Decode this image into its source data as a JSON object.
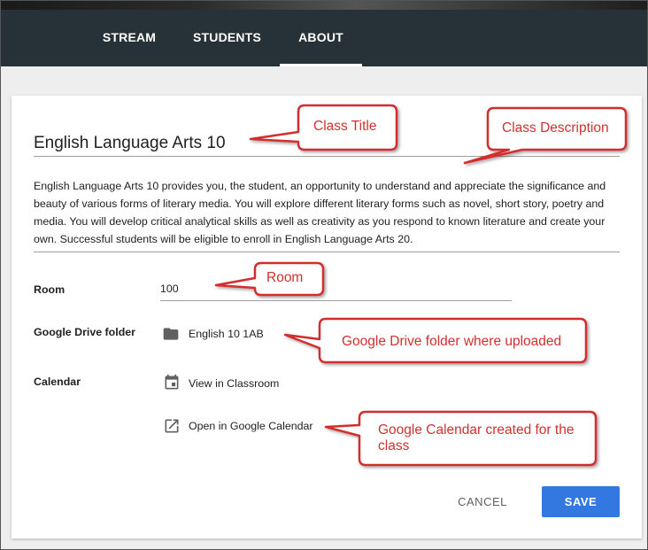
{
  "tabs": [
    {
      "label": "STREAM"
    },
    {
      "label": "STUDENTS"
    },
    {
      "label": "ABOUT"
    }
  ],
  "about": {
    "title": "English Language Arts 10",
    "description": "English Language Arts 10 provides you, the student, an opportunity to understand and appreciate the significance and beauty of various forms of literary media. You will explore different literary forms such as novel, short story, poetry and media. You will develop critical analytical skills as well as creativity as you respond to known literature and create your own. Successful students will be eligible to enroll in English Language Arts 20.",
    "room_label": "Room",
    "room_value": "100",
    "drive_label": "Google Drive folder",
    "drive_folder": "English 10 1AB",
    "calendar_label": "Calendar",
    "view_classroom": "View in Classroom",
    "open_calendar": "Open in Google Calendar"
  },
  "actions": {
    "cancel": "CANCEL",
    "save": "SAVE"
  },
  "annotations": {
    "class_title": "Class Title",
    "class_description": "Class Description",
    "room": "Room",
    "drive": "Google Drive folder where uploaded",
    "calendar": "Google Calendar created for the class"
  },
  "colors": {
    "header": "#263238",
    "save_button": "#3378e0",
    "callout_border": "#d32f2f"
  },
  "icons": {
    "folder": "folder-icon",
    "event": "event-icon",
    "open": "open-in-new-icon"
  }
}
